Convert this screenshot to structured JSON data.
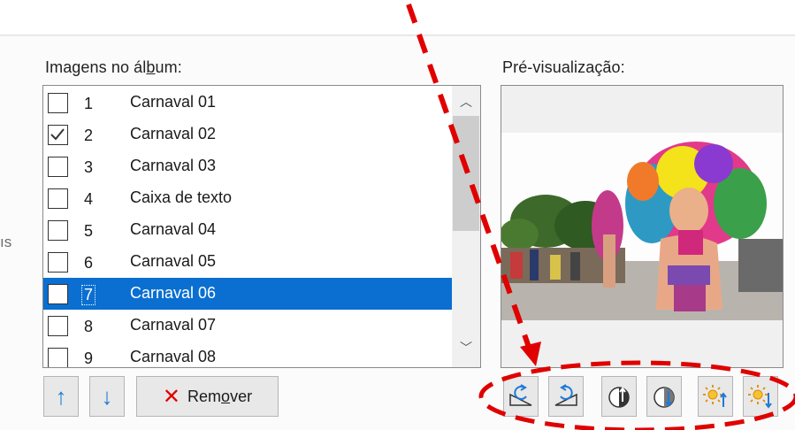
{
  "left_clip_text": "ıs",
  "images_label": {
    "pre": "Imagens no ál",
    "accel": "b",
    "post": "um:"
  },
  "preview_label": "Pré-visualização:",
  "items": [
    {
      "num": "1",
      "name": "Carnaval 01",
      "checked": false,
      "selected": false
    },
    {
      "num": "2",
      "name": "Carnaval 02",
      "checked": true,
      "selected": false
    },
    {
      "num": "3",
      "name": "Carnaval 03",
      "checked": false,
      "selected": false
    },
    {
      "num": "4",
      "name": "Caixa de texto",
      "checked": false,
      "selected": false
    },
    {
      "num": "5",
      "name": "Carnaval 04",
      "checked": false,
      "selected": false
    },
    {
      "num": "6",
      "name": "Carnaval 05",
      "checked": false,
      "selected": false
    },
    {
      "num": "7",
      "name": "Carnaval 06",
      "checked": false,
      "selected": true
    },
    {
      "num": "8",
      "name": "Carnaval 07",
      "checked": false,
      "selected": false
    },
    {
      "num": "9",
      "name": "Carnaval 08",
      "checked": false,
      "selected": false
    }
  ],
  "buttons": {
    "move_up": "↑",
    "move_down": "↓",
    "remove": {
      "pre": "Rem",
      "accel": "o",
      "post": "ver",
      "icon": "✕"
    }
  },
  "preview_tools": [
    {
      "name": "rotate-left-icon"
    },
    {
      "name": "rotate-right-icon"
    },
    {
      "name": "increase-contrast-icon"
    },
    {
      "name": "decrease-contrast-icon"
    },
    {
      "name": "increase-brightness-icon"
    },
    {
      "name": "decrease-brightness-icon"
    }
  ],
  "colors": {
    "selection": "#0a6fd1",
    "annotation": "#e00000",
    "arrow_blue": "#1f7ad6"
  }
}
